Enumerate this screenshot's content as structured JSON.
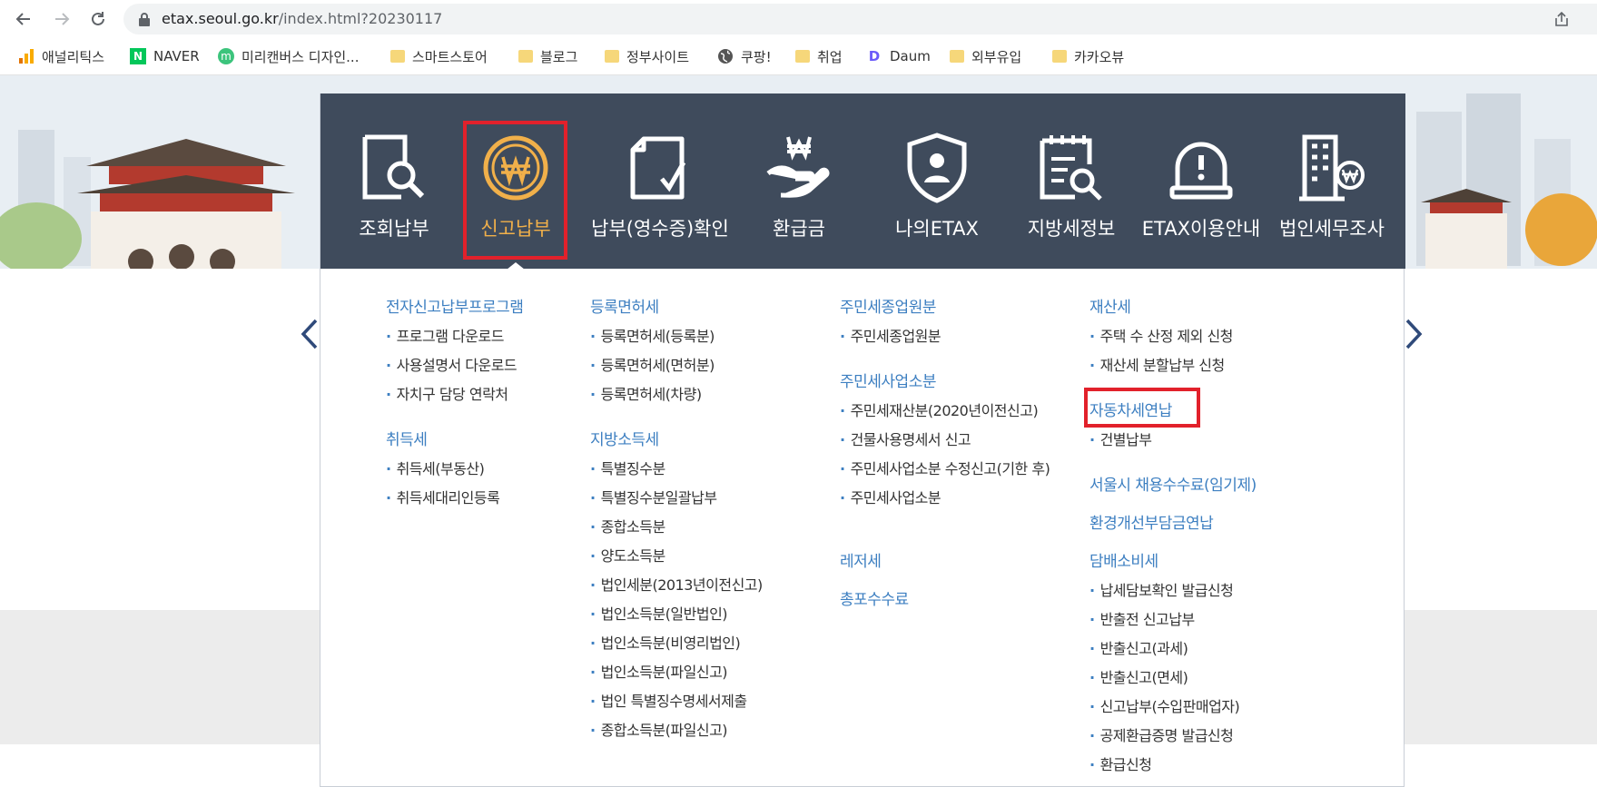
{
  "browser": {
    "url_domain": "etax.seoul.go.kr",
    "url_path": "/index.html?20230117"
  },
  "bookmarks": [
    {
      "label": "애널리틱스",
      "icon": "analytics-icon"
    },
    {
      "label": "NAVER",
      "icon": "naver-icon"
    },
    {
      "label": "미리캔버스 디자인...",
      "icon": "miricanvas-icon"
    },
    {
      "label": "스마트스토어",
      "icon": "folder-icon"
    },
    {
      "label": "블로그",
      "icon": "folder-icon"
    },
    {
      "label": "정부사이트",
      "icon": "folder-icon"
    },
    {
      "label": "쿠팡!",
      "icon": "globe-icon"
    },
    {
      "label": "취업",
      "icon": "folder-icon"
    },
    {
      "label": "Daum",
      "icon": "daum-icon"
    },
    {
      "label": "외부유입",
      "icon": "folder-icon"
    },
    {
      "label": "카카오뷰",
      "icon": "folder-icon"
    }
  ],
  "tabs": [
    {
      "label": "조회납부",
      "icon": "search-document-icon"
    },
    {
      "label": "신고납부",
      "icon": "won-coin-icon",
      "active": true
    },
    {
      "label": "납부(영수증)확인",
      "icon": "receipt-check-icon"
    },
    {
      "label": "환급금",
      "icon": "refund-hand-icon"
    },
    {
      "label": "나의ETAX",
      "icon": "user-shield-icon"
    },
    {
      "label": "지방세정보",
      "icon": "clipboard-search-icon"
    },
    {
      "label": "ETAX이용안내",
      "icon": "alarm-bell-icon"
    },
    {
      "label": "법인세무조사",
      "icon": "building-won-icon"
    }
  ],
  "columns": {
    "col1": {
      "g1": {
        "title": "전자신고납부프로그램",
        "items": [
          "프로그램 다운로드",
          "사용설명서 다운로드",
          "자치구 담당 연락처"
        ]
      },
      "g2": {
        "title": "취득세",
        "items": [
          "취득세(부동산)",
          "취득세대리인등록"
        ]
      }
    },
    "col2": {
      "g1": {
        "title": "등록면허세",
        "items": [
          "등록면허세(등록분)",
          "등록면허세(면허분)",
          "등록면허세(차량)"
        ]
      },
      "g2": {
        "title": "지방소득세",
        "items": [
          "특별징수분",
          "특별징수분일괄납부",
          "종합소득분",
          "양도소득분",
          "법인세분(2013년이전신고)",
          "법인소득분(일반법인)",
          "법인소득분(비영리법인)",
          "법인소득분(파일신고)",
          "법인 특별징수명세서제출",
          "종합소득분(파일신고)"
        ]
      }
    },
    "col3": {
      "g1": {
        "title": "주민세종업원분",
        "items": [
          "주민세종업원분"
        ]
      },
      "g2": {
        "title": "주민세사업소분",
        "items": [
          "주민세재산분(2020년이전신고)",
          "건물사용명세서 신고",
          "주민세사업소분 수정신고(기한 후)",
          "주민세사업소분"
        ]
      },
      "g3": {
        "title": "레저세"
      },
      "g4": {
        "title": "총포수수료"
      }
    },
    "col4": {
      "g1": {
        "title": "재산세",
        "items": [
          "주택 수 산정 제외 신청",
          "재산세 분할납부 신청"
        ]
      },
      "g2": {
        "title": "자동차세연납",
        "items": [
          "건별납부"
        ]
      },
      "g3": {
        "title": "서울시 채용수수료(임기제)"
      },
      "g4": {
        "title": "환경개선부담금연납"
      },
      "g5": {
        "title": "담배소비세",
        "items": [
          "납세담보확인 발급신청",
          "반출전 신고납부",
          "반출신고(과세)",
          "반출신고(면세)",
          "신고납부(수입판매업자)",
          "공제환급증명 발급신청",
          "환급신청"
        ]
      }
    }
  },
  "colors": {
    "menu_bg": "#3f4b5c",
    "active": "#f1b04a",
    "link": "#3d7fc1",
    "highlight": "#e2212b"
  }
}
